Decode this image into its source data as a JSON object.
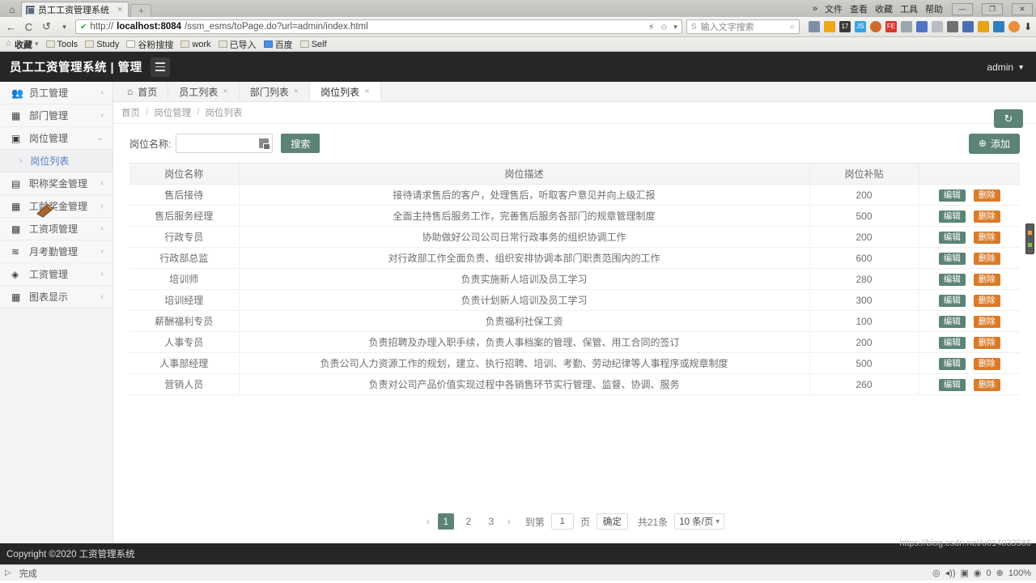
{
  "browser": {
    "tab_title": "员工工资管理系统",
    "tab_close": "×",
    "newtab_label": "+",
    "home_icon": "⌂",
    "menu_more": "»",
    "menus": [
      "文件",
      "查看",
      "收藏",
      "工具",
      "帮助"
    ],
    "win_min": "—",
    "win_max": "❐",
    "win_close": "✕",
    "nav_back": "←",
    "nav_reload": "C",
    "nav_history": "↺",
    "nav_dropdown": "▾",
    "url_lock": "✔",
    "url_prefix": "http://",
    "url_host": "localhost:8084",
    "url_path": "/ssm_esms/toPage.do?url=admin/index.html",
    "url_lightning": "⚡",
    "url_star": "☆",
    "url_caret": "▾",
    "search_engine_icon": "S",
    "search_placeholder": "输入文字搜索",
    "search_icon": "⌕",
    "download_icon": "⬇",
    "bookmarks": [
      "收藏",
      "Tools",
      "Study",
      "谷粉搜搜",
      "work",
      "已导入",
      "百度",
      "Self"
    ]
  },
  "app": {
    "title": "员工工资管理系统 | 管理",
    "user": "admin",
    "user_caret": "▼"
  },
  "sidebar": {
    "items": [
      {
        "label": "员工管理",
        "icon": "users-icon",
        "glyph": "👥",
        "caret": "‹"
      },
      {
        "label": "部门管理",
        "icon": "sitemap-icon",
        "glyph": "⛬",
        "caret": "‹"
      },
      {
        "label": "岗位管理",
        "icon": "badge-icon",
        "glyph": "▯",
        "caret": "⌄"
      }
    ],
    "sub_item": {
      "label": "岗位列表",
      "arrow": "›"
    },
    "items_after": [
      {
        "label": "职称奖金管理",
        "icon": "briefcase-icon",
        "glyph": "▤",
        "caret": "‹"
      },
      {
        "label": "工龄奖金管理",
        "icon": "printer-icon",
        "glyph": "▦",
        "caret": "‹"
      },
      {
        "label": "工资项管理",
        "icon": "wallet-icon",
        "glyph": "▥",
        "caret": "‹"
      },
      {
        "label": "月考勤管理",
        "icon": "layers-icon",
        "glyph": "≋",
        "caret": "‹"
      },
      {
        "label": "工资管理",
        "icon": "tag-icon",
        "glyph": "🏷",
        "caret": "‹"
      },
      {
        "label": "图表显示",
        "icon": "chart-icon",
        "glyph": "▤",
        "caret": "‹"
      }
    ]
  },
  "tabs": [
    {
      "label": "首页",
      "icon": "home-icon",
      "closable": false,
      "active": false
    },
    {
      "label": "员工列表",
      "icon": "",
      "closable": true,
      "active": false
    },
    {
      "label": "部门列表",
      "icon": "",
      "closable": true,
      "active": false
    },
    {
      "label": "岗位列表",
      "icon": "",
      "closable": true,
      "active": true
    }
  ],
  "breadcrumb": {
    "items": [
      "首页",
      "岗位管理",
      "岗位列表"
    ],
    "separator": "/"
  },
  "toolbar": {
    "refresh_icon": "↻",
    "search_label": "岗位名称:",
    "search_value": "",
    "search_placeholder": "",
    "search_button": "搜索",
    "add_button": "添加",
    "add_icon": "⊕"
  },
  "table": {
    "columns": [
      "岗位名称",
      "岗位描述",
      "岗位补贴",
      ""
    ],
    "edit_label": "编辑",
    "delete_label": "删除",
    "rows": [
      {
        "name": "售后接待",
        "desc": "接待请求售后的客户，处理售后，听取客户意见并向上级汇报",
        "subsidy": "200"
      },
      {
        "name": "售后服务经理",
        "desc": "全面主持售后服务工作，完善售后服务各部门的规章管理制度",
        "subsidy": "500"
      },
      {
        "name": "行政专员",
        "desc": "协助做好公司公司日常行政事务的组织协调工作",
        "subsidy": "200"
      },
      {
        "name": "行政部总监",
        "desc": "对行政部工作全面负责、组织安排协调本部门职责范围内的工作",
        "subsidy": "600"
      },
      {
        "name": "培训师",
        "desc": "负责实施新人培训及员工学习",
        "subsidy": "280"
      },
      {
        "name": "培训经理",
        "desc": "负责计划新人培训及员工学习",
        "subsidy": "300"
      },
      {
        "name": "薪酬福利专员",
        "desc": "负责福利社保工资",
        "subsidy": "100"
      },
      {
        "name": "人事专员",
        "desc": "负责招聘及办理入职手续，负责人事档案的管理、保管、用工合同的签订",
        "subsidy": "200"
      },
      {
        "name": "人事部经理",
        "desc": "负责公司人力资源工作的规划，建立、执行招聘、培训、考勤、劳动纪律等人事程序或规章制度",
        "subsidy": "500"
      },
      {
        "name": "营销人员",
        "desc": "负责对公司产品价值实现过程中各销售环节实行管理、监督、协调、服务",
        "subsidy": "260"
      }
    ]
  },
  "pagination": {
    "prev": "‹",
    "next": "›",
    "pages": [
      "1",
      "2",
      "3"
    ],
    "current": "1",
    "goto_label": "到第",
    "goto_value": "1",
    "page_unit": "页",
    "confirm": "确定",
    "total": "共21条",
    "page_size": "10 条/页",
    "caret": "▾"
  },
  "footer": {
    "copyright": "Copyright ©2020 工资管理系统"
  },
  "statusbar": {
    "play_icon": "▷",
    "status_text": "完成",
    "hover_link": "https://blog.csdn.net/u014033586",
    "shield_icon": "◎",
    "sound_icon": "◂))",
    "box_icon": "▣",
    "target_icon": "◉",
    "count": "0",
    "zoom_icon": "⊕",
    "zoom": "100%"
  },
  "colors": {
    "accent": "#5b8376",
    "danger": "#d97b28",
    "header_bg": "#262626",
    "sidebar_bg": "#f5f5f6"
  }
}
